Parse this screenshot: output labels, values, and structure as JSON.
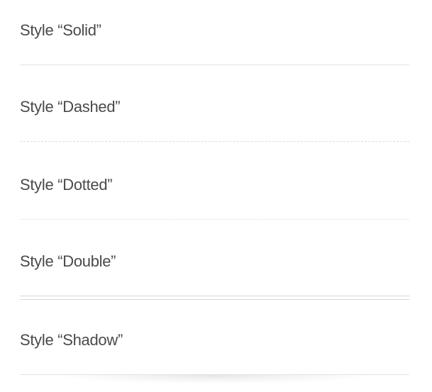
{
  "sections": [
    {
      "label": "Style “Solid”",
      "style": "solid"
    },
    {
      "label": "Style “Dashed”",
      "style": "dashed"
    },
    {
      "label": "Style “Dotted”",
      "style": "dotted"
    },
    {
      "label": "Style “Double”",
      "style": "double"
    },
    {
      "label": "Style “Shadow”",
      "style": "shadow"
    }
  ],
  "colors": {
    "text": "#4a4a4a",
    "divider": "#e2e2e2",
    "background": "#ffffff"
  }
}
